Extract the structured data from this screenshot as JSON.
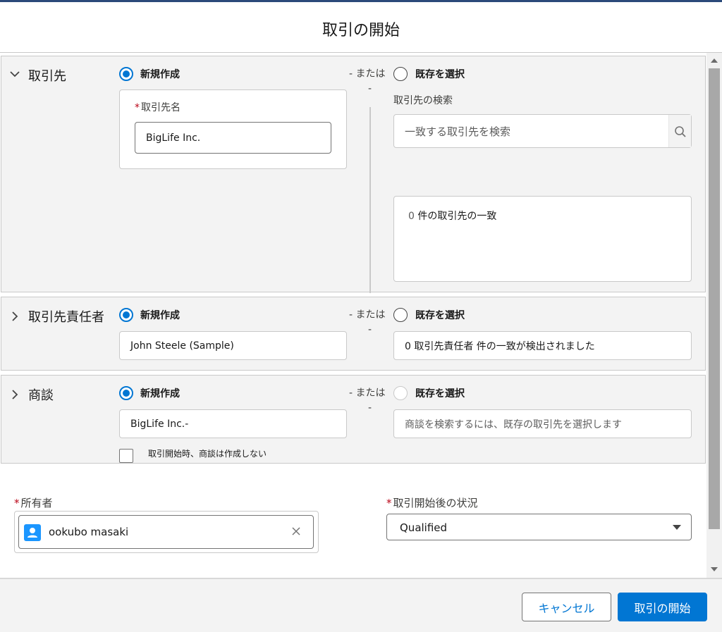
{
  "dialog": {
    "title": "取引の開始"
  },
  "or_text": "- または",
  "dash": "-",
  "account": {
    "title": "取引先",
    "new_label": "新規作成",
    "existing_label": "既存を選択",
    "name_label": "取引先名",
    "name_value": "BigLife Inc.",
    "search_label": "取引先の検索",
    "search_placeholder": "一致する取引先を検索",
    "results_count": "0",
    "results_text": "件の取引先の一致"
  },
  "contact": {
    "title": "取引先責任者",
    "new_label": "新規作成",
    "existing_label": "既存を選択",
    "name_value": "John Steele (Sample)",
    "match_text": "0 取引先責任者 件の一致が検出されました"
  },
  "opportunity": {
    "title": "商談",
    "new_label": "新規作成",
    "existing_label": "既存を選択",
    "name_value": "BigLife Inc.-",
    "search_hint": "商談を検索するには、既存の取引先を選択します",
    "no_opp_label": "取引開始時、商談は作成しない"
  },
  "owner": {
    "label": "所有者",
    "value": "ookubo masaki"
  },
  "status": {
    "label": "取引開始後の状況",
    "value": "Qualified"
  },
  "footer": {
    "cancel_label": "キャンセル",
    "submit_label": "取引の開始"
  },
  "colors": {
    "brand": "#0176d3",
    "required": "#ba0517",
    "section_bg": "#f3f3f3"
  }
}
